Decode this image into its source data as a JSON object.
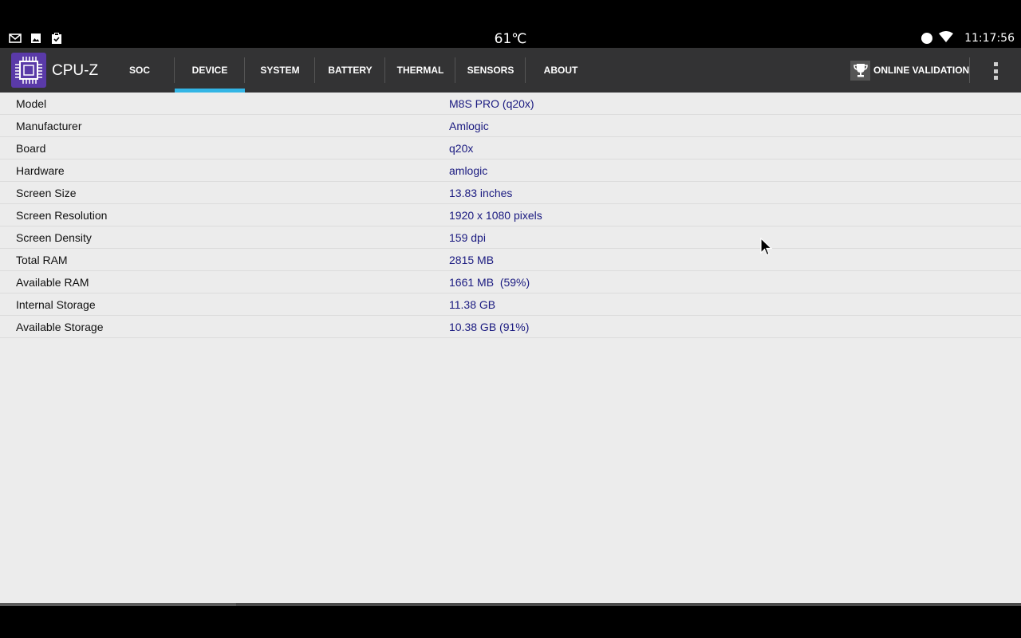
{
  "status_bar": {
    "temperature": "61℃",
    "time": "11:17:56",
    "icons_left": [
      "gmail-icon",
      "gallery-icon",
      "clipboard-icon"
    ],
    "icons_right": [
      "circle-icon",
      "wifi-icon"
    ]
  },
  "app": {
    "title": "CPU-Z",
    "logo_icon": "cpu-chip-icon",
    "accent_color": "#33b5e5",
    "logo_color": "#5a3aa8"
  },
  "tabs": [
    {
      "label": "SOC",
      "active": false
    },
    {
      "label": "DEVICE",
      "active": true
    },
    {
      "label": "SYSTEM",
      "active": false
    },
    {
      "label": "BATTERY",
      "active": false
    },
    {
      "label": "THERMAL",
      "active": false
    },
    {
      "label": "SENSORS",
      "active": false
    },
    {
      "label": "ABOUT",
      "active": false
    }
  ],
  "toolbar": {
    "validation_label": "ONLINE VALIDATION",
    "validation_icon": "trophy-icon",
    "menu_icon": "overflow-menu-icon"
  },
  "device_info": [
    {
      "label": "Model",
      "value": "M8S PRO (q20x)"
    },
    {
      "label": "Manufacturer",
      "value": "Amlogic"
    },
    {
      "label": "Board",
      "value": "q20x"
    },
    {
      "label": "Hardware",
      "value": "amlogic"
    },
    {
      "label": "Screen Size",
      "value": "13.83 inches"
    },
    {
      "label": "Screen Resolution",
      "value": "1920 x 1080 pixels"
    },
    {
      "label": "Screen Density",
      "value": "159 dpi"
    },
    {
      "label": "Total RAM",
      "value": "2815 MB"
    },
    {
      "label": "Available RAM",
      "value": "1661 MB  (59%)"
    },
    {
      "label": "Internal Storage",
      "value": "11.38 GB"
    },
    {
      "label": "Available Storage",
      "value": "10.38 GB (91%)"
    }
  ]
}
